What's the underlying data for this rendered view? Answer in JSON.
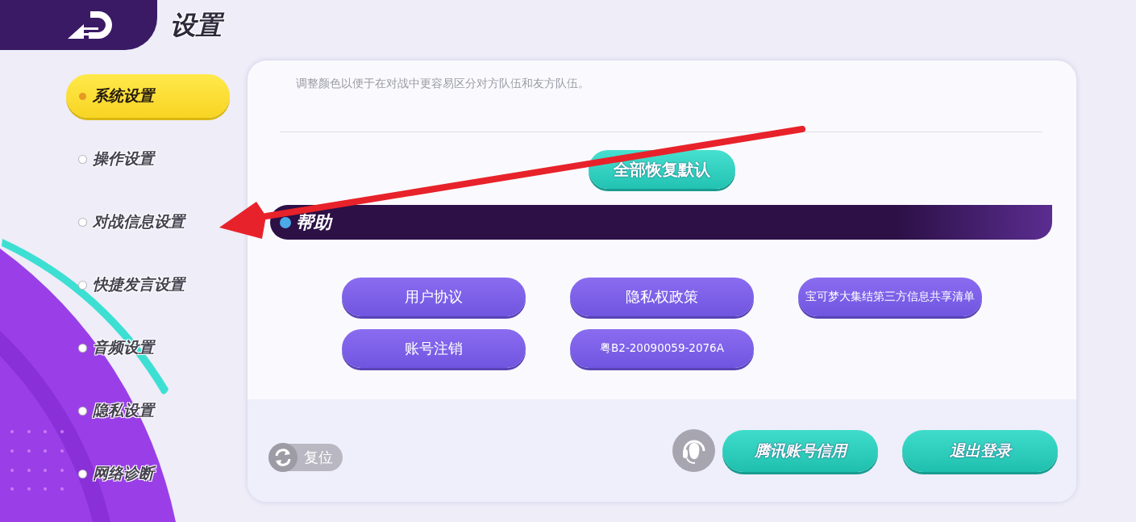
{
  "header": {
    "title": "设置"
  },
  "sidebar": {
    "items": [
      {
        "label": "系统设置",
        "selected": true
      },
      {
        "label": "操作设置",
        "selected": false
      },
      {
        "label": "对战信息设置",
        "selected": false
      },
      {
        "label": "快捷发言设置",
        "selected": false
      },
      {
        "label": "音频设置",
        "selected": false
      },
      {
        "label": "隐私设置",
        "selected": false
      },
      {
        "label": "网络诊断",
        "selected": false
      }
    ]
  },
  "panel": {
    "description": "调整颜色以便于在对战中更容易区分对方队伍和友方队伍。",
    "restore_button": "全部恢复默认",
    "help": {
      "title": "帮助",
      "buttons": [
        {
          "label": "用户协议",
          "kind": "large"
        },
        {
          "label": "隐私权政策",
          "kind": "large"
        },
        {
          "label": "宝可梦大集结第三方信息共享清单",
          "kind": "small"
        },
        {
          "label": "账号注销",
          "kind": "large"
        },
        {
          "label": "粤B2-20090059-2076A",
          "kind": "small"
        }
      ]
    },
    "footer": {
      "reset_button": "复位",
      "buttons": [
        "腾讯账号信用",
        "退出登录"
      ]
    }
  }
}
